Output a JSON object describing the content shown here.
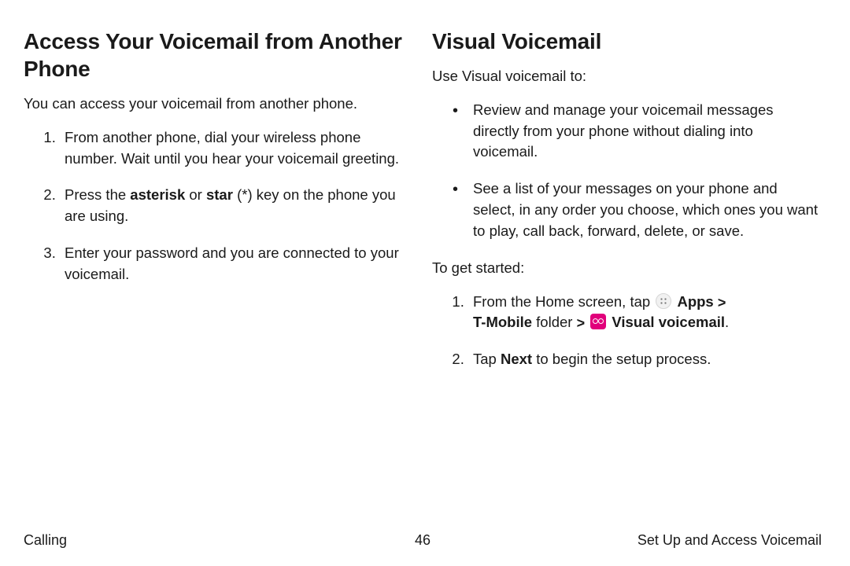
{
  "left": {
    "heading": "Access Your Voicemail from Another Phone",
    "intro": "You can access your voicemail from another phone.",
    "steps": {
      "s1": "From another phone, dial your wireless phone number. Wait until you hear your voicemail greeting.",
      "s2a": "Press the ",
      "s2b": "asterisk",
      "s2c": " or ",
      "s2d": "star",
      "s2e": " (*) key on the phone you are using.",
      "s3": "Enter your password and you are connected to your voicemail."
    }
  },
  "right": {
    "heading": "Visual Voicemail",
    "intro": "Use Visual voicemail to:",
    "bullets": {
      "b1": "Review and manage your voicemail messages directly from your phone without dialing into voicemail.",
      "b2": "See a list of your messages on your phone and select, in any order you choose, which ones you want to play, call back, forward, delete, or save."
    },
    "start": "To get started:",
    "steps": {
      "s1a": "From the Home screen, tap ",
      "s1_apps": "Apps",
      "s1_tmobile": "T-Mobile",
      "s1_folder": " folder ",
      "s1_vv": "Visual voicemail",
      "s1_period": ".",
      "s2a": "Tap ",
      "s2b": "Next",
      "s2c": " to begin the setup process."
    }
  },
  "chev": ">",
  "footer": {
    "left": "Calling",
    "center": "46",
    "right": "Set Up and Access Voicemail"
  }
}
